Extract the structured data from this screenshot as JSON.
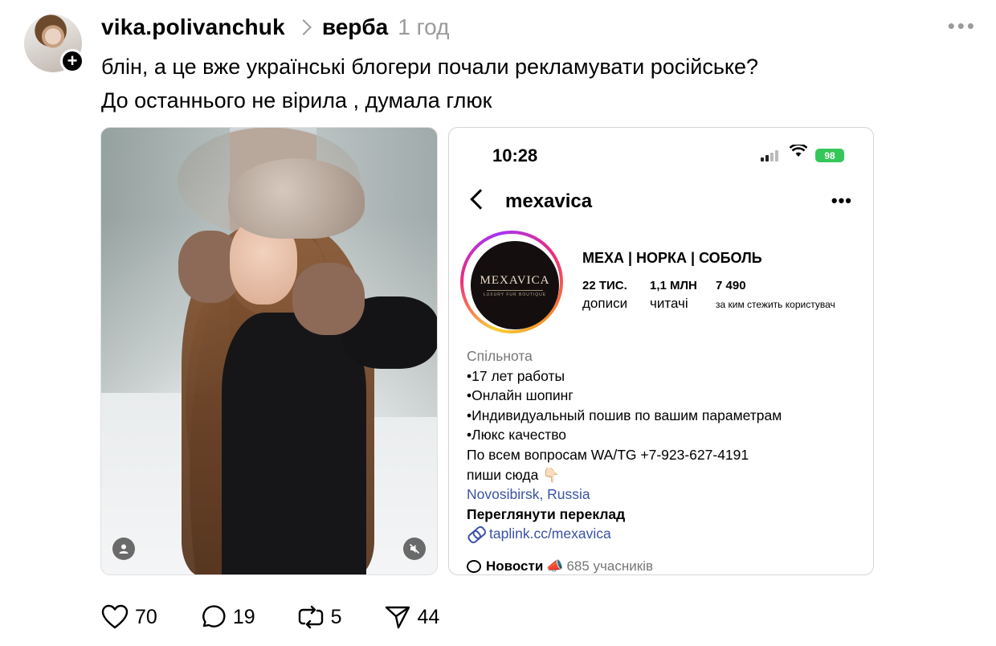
{
  "post": {
    "username": "vika.polivanchuk",
    "topic": "верба",
    "time": "1 год",
    "text_line1": "блін, а це вже українські блогери почали рекламувати російське?",
    "text_line2": "До останнього не вірила , думала глюк"
  },
  "screenshot": {
    "status_time": "10:28",
    "battery": "98",
    "handle": "mexavica",
    "logo_text": "MEXAVICA",
    "logo_subtext": "LUXURY FUR BOUTIQUE",
    "profile_name": "МЕХА | НОРКА | СОБОЛЬ",
    "stats": [
      {
        "num": "22 ТИС.",
        "label": "дописи"
      },
      {
        "num": "1,1 МЛН",
        "label": "читачі"
      },
      {
        "num": "7 490",
        "label": "за ким стежить користувач"
      }
    ],
    "bio": {
      "category": "Спільнота",
      "line1": "•17 лет работы",
      "line2": "•Онлайн шопинг",
      "line3": "•Индивидуальный пошив по вашим параметрам",
      "line4": "•Люкс качество",
      "line5": "По всем вопросам WA/TG +7-923-627-4191",
      "line6": "пиши сюда 👇🏻",
      "location": "Novosibirsk, Russia",
      "translate": "Переглянути переклад",
      "url": "taplink.cc/mexavica"
    },
    "community": {
      "name": "Новости",
      "emoji": "📣",
      "members": "685 учасників"
    }
  },
  "actions": {
    "likes": "70",
    "replies": "19",
    "reposts": "5",
    "shares": "44"
  }
}
